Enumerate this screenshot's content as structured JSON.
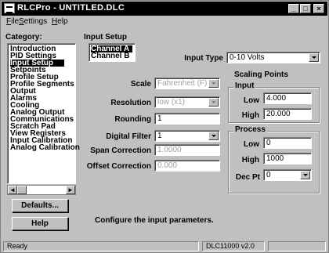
{
  "window": {
    "title": "RLCPro - UNTITLED.DLC",
    "controls": {
      "minimize": "_",
      "maximize": "□",
      "close": "×"
    }
  },
  "menubar": {
    "items": [
      {
        "u": "F",
        "rest": "ile"
      },
      {
        "u": "S",
        "rest": "ettings"
      },
      {
        "u": "H",
        "rest": "elp"
      }
    ]
  },
  "sidebar": {
    "label": "Category:",
    "items": [
      "Introduction",
      "PID Settings",
      "Input Setup",
      "Setpoints",
      "Profile Setup",
      "Profile Segments",
      "Output",
      "Alarms",
      "Cooling",
      "Analog Output",
      "Communications",
      "Scratch Pad",
      "View Registers",
      "Input Calibration",
      "Analog Calibration"
    ],
    "selected_index": 2,
    "scroll_left": "◄",
    "scroll_right": "►",
    "defaults_button": "Defaults...",
    "help_button": "Help"
  },
  "main": {
    "title": "Input Setup",
    "channels": [
      "Channel A",
      "Channel B"
    ],
    "selected_channel": 0,
    "input_type": {
      "label": "Input Type",
      "value": "0-10 Volts"
    },
    "scale": {
      "label": "Scale",
      "value": "Fahrenheit (F)"
    },
    "resolution": {
      "label": "Resolution",
      "value": "low (x1)"
    },
    "rounding": {
      "label": "Rounding",
      "value": "1"
    },
    "digital_filter": {
      "label": "Digital Filter",
      "value": "1"
    },
    "span_correction": {
      "label": "Span Correction",
      "value": "1.0000"
    },
    "offset_correction": {
      "label": "Offset Correction",
      "value": "0.000"
    },
    "scaling": {
      "title": "Scaling Points",
      "input": {
        "title": "Input",
        "low_label": "Low",
        "low": "4.000",
        "high_label": "High",
        "high": "20.000"
      },
      "process": {
        "title": "Process",
        "low_label": "Low",
        "low": "0",
        "high_label": "High",
        "high": "1000",
        "decpt_label": "Dec Pt",
        "decpt": "0"
      }
    },
    "hint": "Configure the input parameters."
  },
  "status": {
    "left": "Ready",
    "version": "DLC11000 v2.0"
  }
}
